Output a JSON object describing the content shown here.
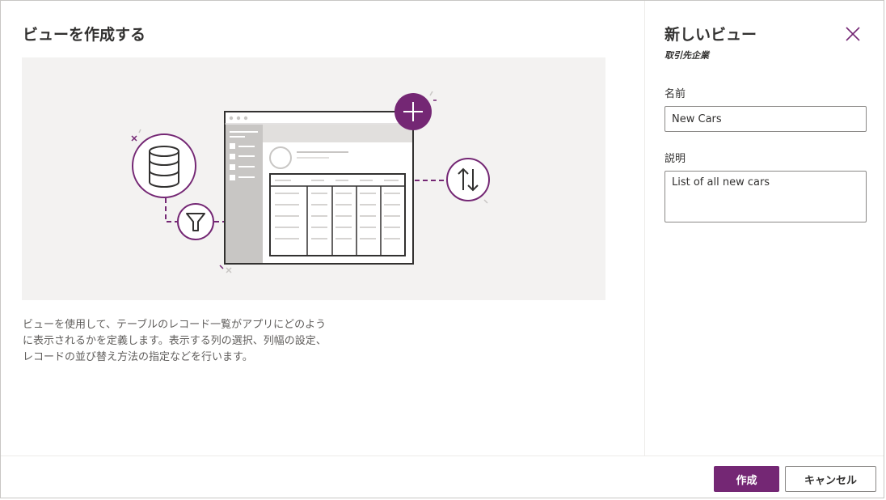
{
  "main": {
    "title": "ビューを作成する",
    "illustration_icons": [
      "database-icon",
      "filter-icon",
      "window-mockup",
      "add-icon",
      "sort-icon"
    ],
    "description_lines": [
      "ビューを使用して、テーブルのレコード一覧がアプリにどのよう",
      "に表示されるかを定義します。表示する列の選択、列幅の設定、",
      "レコードの並び替え方法の指定などを行います。"
    ]
  },
  "panel": {
    "title": "新しいビュー",
    "subtitle": "取引先企業",
    "name_label": "名前",
    "name_value": "New Cars",
    "description_label": "説明",
    "description_value": "List of all new cars",
    "close_icon": "close-icon"
  },
  "footer": {
    "create_label": "作成",
    "cancel_label": "キャンセル"
  },
  "colors": {
    "accent": "#742774",
    "illustration_bg": "#f3f2f1",
    "text": "#323130",
    "secondary_text": "#605e5c"
  }
}
